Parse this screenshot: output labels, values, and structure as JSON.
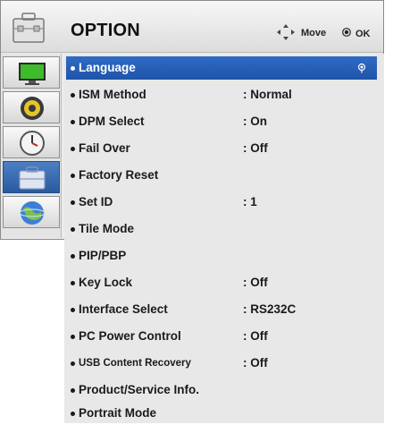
{
  "header": {
    "title": "OPTION",
    "move_label": "Move",
    "ok_label": "OK",
    "icon": "toolbox-icon"
  },
  "sidebar": {
    "items": [
      {
        "name": "picture",
        "icon": "monitor-icon",
        "active": false
      },
      {
        "name": "audio",
        "icon": "speaker-icon",
        "active": false
      },
      {
        "name": "time",
        "icon": "clock-icon",
        "active": false
      },
      {
        "name": "option",
        "icon": "toolbox-icon",
        "active": true
      },
      {
        "name": "network",
        "icon": "globe-icon",
        "active": false
      }
    ]
  },
  "menu": {
    "items": [
      {
        "label": "Language",
        "value": "",
        "selected": true
      },
      {
        "label": "ISM Method",
        "value": ": Normal"
      },
      {
        "label": "DPM Select",
        "value": ": On"
      },
      {
        "label": "Fail Over",
        "value": ": Off"
      },
      {
        "label": "Factory Reset",
        "value": ""
      },
      {
        "label": "Set ID",
        "value": ": 1"
      },
      {
        "label": "Tile Mode",
        "value": ""
      },
      {
        "label": "PIP/PBP",
        "value": ""
      },
      {
        "label": "Key Lock",
        "value": ": Off"
      },
      {
        "label": "Interface Select",
        "value": ": RS232C"
      },
      {
        "label": "PC Power Control",
        "value": ": Off"
      },
      {
        "label": "USB Content Recovery",
        "value": ": Off"
      },
      {
        "label": "Product/Service Info.",
        "value": ""
      },
      {
        "label": "Portrait Mode",
        "value": ""
      }
    ]
  },
  "colors": {
    "selected": "#2f6bc6",
    "panel": "#e8e8e8"
  }
}
